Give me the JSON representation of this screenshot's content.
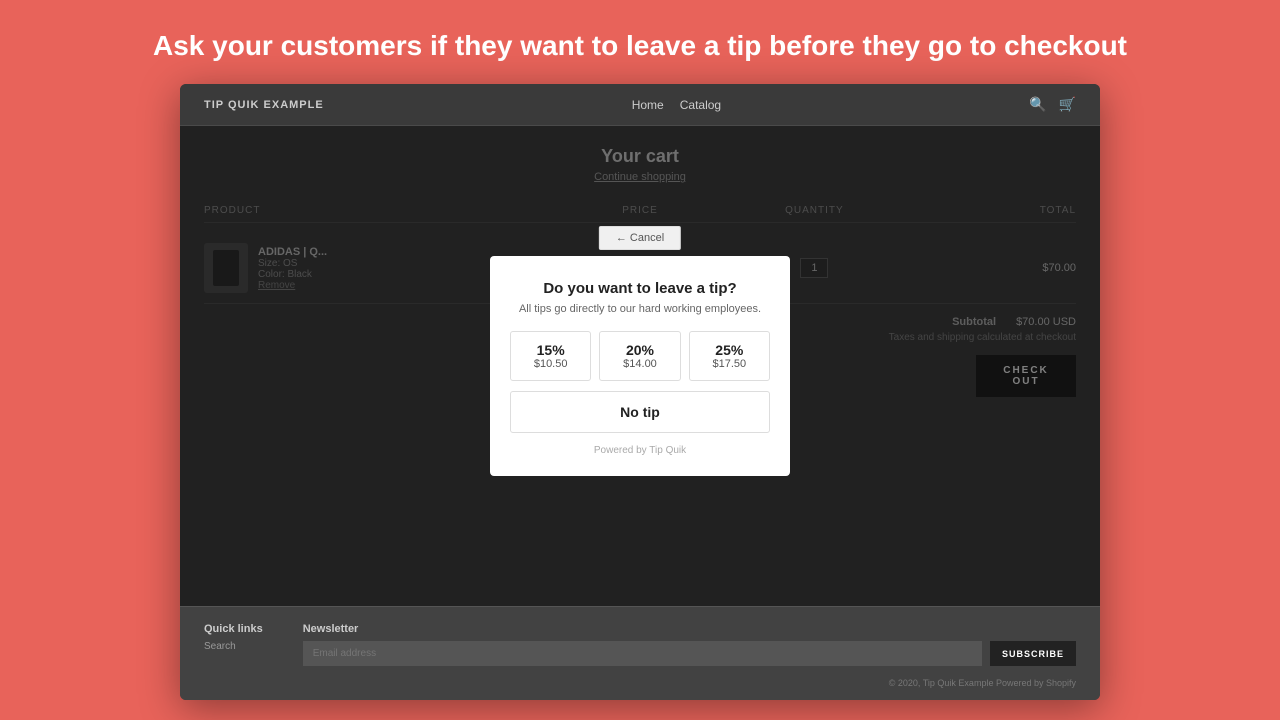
{
  "headline": "Ask your customers if they want to leave a tip before they go to checkout",
  "store": {
    "logo": "TIP QUIK EXAMPLE",
    "nav": [
      "Home",
      "Catalog"
    ],
    "cart": {
      "title": "Your cart",
      "continue_shopping": "Continue shopping",
      "columns": [
        "PRODUCT",
        "PRICE",
        "QUANTITY",
        "TOTAL"
      ],
      "item": {
        "name": "ADIDAS | Q...",
        "detail1": "Size: OS",
        "detail2": "Color: Black",
        "remove": "Remove",
        "price": "",
        "quantity": "1",
        "total": "$70.00"
      },
      "subtotal_label": "Subtotal",
      "subtotal_value": "$70.00 USD",
      "tax_note": "Taxes and shipping calculated at checkout"
    },
    "checkout_button": "CHECK OUT",
    "footer": {
      "quick_links_title": "Quick links",
      "quick_links": [
        "Search"
      ],
      "newsletter_title": "Newsletter",
      "email_placeholder": "Email address",
      "subscribe_label": "SUBSCRIBE",
      "copyright": "© 2020, Tip Quik Example Powered by Shopify"
    }
  },
  "modal": {
    "cancel_label": "← Cancel",
    "title": "Do you want to leave a tip?",
    "subtitle": "All tips go directly to our hard working employees.",
    "tip_options": [
      {
        "percent": "15%",
        "amount": "$10.50"
      },
      {
        "percent": "20%",
        "amount": "$14.00"
      },
      {
        "percent": "25%",
        "amount": "$17.50"
      }
    ],
    "no_tip_label": "No tip",
    "powered_by": "Powered by Tip Quik"
  },
  "icons": {
    "search": "🔍",
    "bag": "🛍"
  }
}
